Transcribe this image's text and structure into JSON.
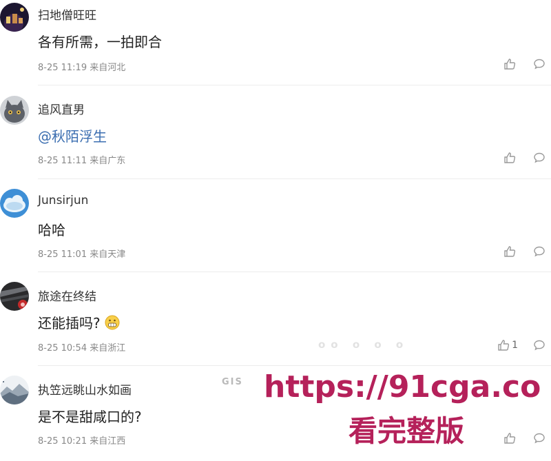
{
  "comments": [
    {
      "username": "扫地僧旺旺",
      "content": "各有所需，一拍即合",
      "meta": "8-25 11:19 来自河北",
      "avatar": "dark-night-avatar",
      "like_count": ""
    },
    {
      "username": "追风直男",
      "content": "@秋陌浮生",
      "meta": "8-25 11:11 来自广东",
      "avatar": "gray-cat-avatar",
      "like_count": ""
    },
    {
      "username": "Junsirjun",
      "content": "哈哈",
      "meta": "8-25 11:01 来自天津",
      "avatar": "blue-cloud-avatar",
      "like_count": ""
    },
    {
      "username": "旅途在终结",
      "content": "还能插吗?",
      "meta": "8-25 10:54 来自浙江",
      "avatar": "dark-car-avatar",
      "like_count": "1"
    },
    {
      "username": "执笠远眺山水如画",
      "content": "是不是甜咸口的?",
      "meta": "8-25 10:21 来自江西",
      "avatar": "landscape-avatar",
      "like_count": ""
    }
  ],
  "watermark": {
    "line1": "https://91cga.co",
    "line2": "看完整版",
    "color": "#b5215a"
  },
  "colors": {
    "mention": "#3a6db0",
    "meta": "#888888",
    "divider": "#ececec"
  }
}
